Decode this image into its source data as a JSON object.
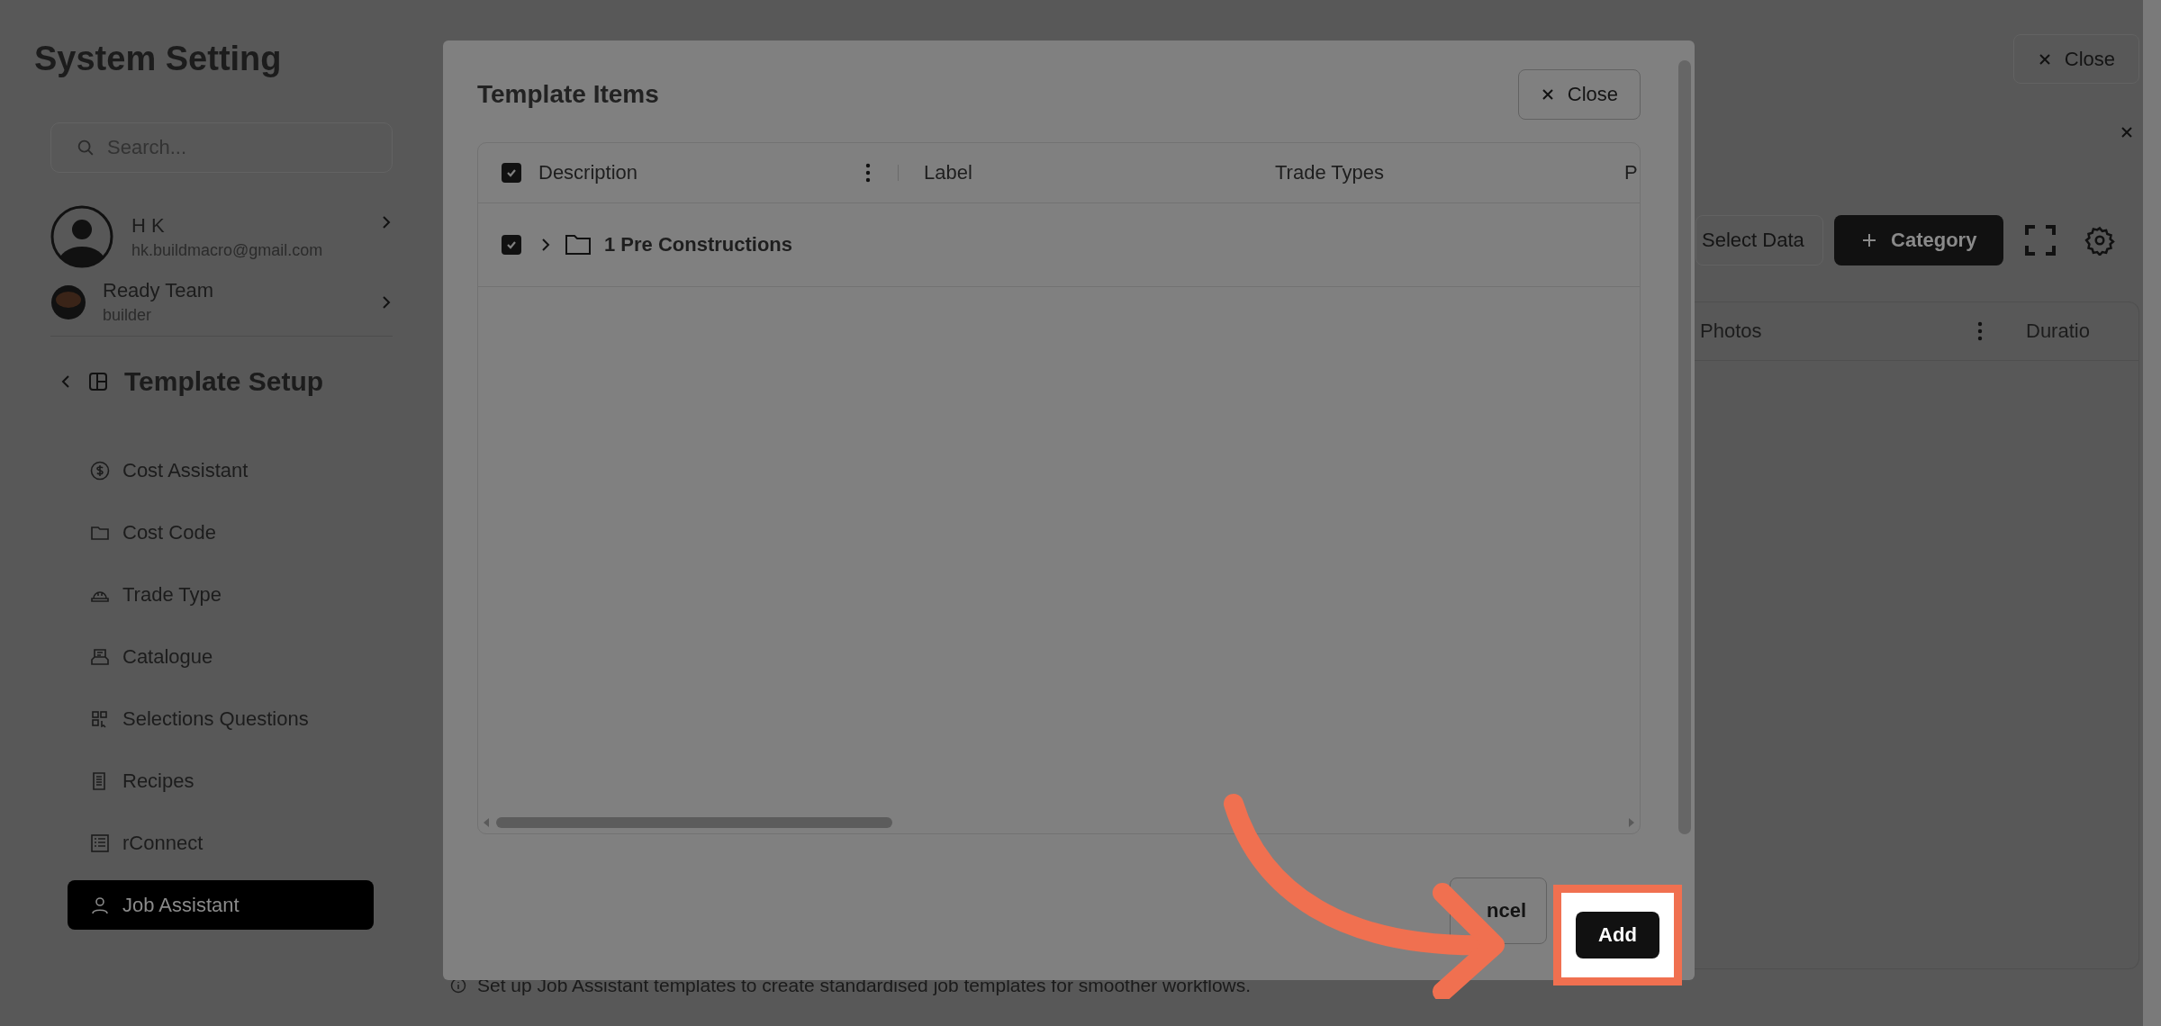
{
  "sidebar": {
    "title": "System Setting",
    "search": {
      "placeholder": "Search..."
    },
    "user": {
      "name": "H K",
      "email": "hk.buildmacro@gmail.com"
    },
    "team": {
      "name": "Ready Team",
      "role": "builder"
    },
    "section": "Template Setup",
    "items": [
      {
        "label": "Cost Assistant",
        "selected": false
      },
      {
        "label": "Cost Code",
        "selected": false
      },
      {
        "label": "Trade Type",
        "selected": false
      },
      {
        "label": "Catalogue",
        "selected": false
      },
      {
        "label": "Selections Questions",
        "selected": false
      },
      {
        "label": "Recipes",
        "selected": false
      },
      {
        "label": "rConnect",
        "selected": false
      },
      {
        "label": "Job Assistant",
        "selected": true
      }
    ]
  },
  "main": {
    "close_button": "Close",
    "select_data_button": "Select Data",
    "category_button": "Category",
    "columns": [
      "Photos",
      "Duratio"
    ],
    "info": "Set up Job Assistant templates to create standardised job templates for smoother workflows."
  },
  "modal": {
    "title": "Template Items",
    "close_button": "Close",
    "table": {
      "header_checked": true,
      "columns": [
        "Description",
        "Label",
        "Trade Types",
        "P"
      ],
      "rows": [
        {
          "label": "1 Pre Constructions",
          "checked": true,
          "expanded": false
        }
      ]
    },
    "cancel_button": "ncel",
    "add_button": "Add"
  }
}
